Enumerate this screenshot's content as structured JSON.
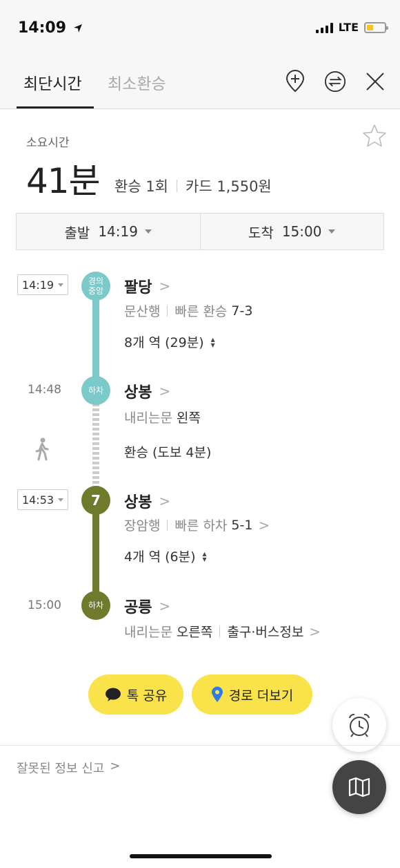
{
  "status_bar": {
    "time": "14:09",
    "network": "LTE"
  },
  "tabs": {
    "active": "최단시간",
    "inactive": "최소환승"
  },
  "summary": {
    "label": "소요시간",
    "duration": "41분",
    "transfers": "환승 1회",
    "fare": "카드 1,550원",
    "depart_label": "출발",
    "depart_time": "14:19",
    "arrive_label": "도착",
    "arrive_time": "15:00"
  },
  "route": {
    "seg1": {
      "time": "14:19",
      "badge": "경의\n중앙",
      "station": "팔당",
      "direction": "문산행",
      "fast_label": "빠른 환승",
      "fast_value": "7-3",
      "stops": "8개 역 (29분)"
    },
    "alight1": {
      "time": "14:48",
      "badge": "하차",
      "station": "상봉",
      "door_label": "내리는문",
      "door_value": "왼쪽"
    },
    "walk": {
      "text": "환승 (도보 4분)"
    },
    "seg2": {
      "time": "14:53",
      "badge": "7",
      "station": "상봉",
      "direction": "장암행",
      "fast_label": "빠른 하차",
      "fast_value": "5-1",
      "stops": "4개 역 (6분)"
    },
    "alight2": {
      "time": "15:00",
      "badge": "하차",
      "station": "공릉",
      "door_label": "내리는문",
      "door_value": "오른쪽",
      "exit_info": "출구·버스정보"
    }
  },
  "actions": {
    "share": "톡 공유",
    "more": "경로 더보기"
  },
  "report": "잘못된 정보 신고",
  "colors": {
    "line_gyeongui": "#7bc9c9",
    "line_7": "#6f7a2c",
    "button": "#fae34a"
  }
}
